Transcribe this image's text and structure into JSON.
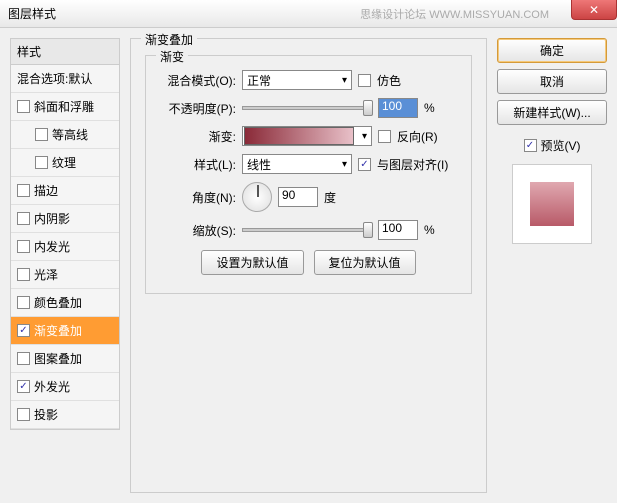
{
  "window": {
    "title": "图层样式",
    "watermark": "思缘设计论坛  WWW.MISSYUAN.COM"
  },
  "left": {
    "header": "样式",
    "blendDefault": "混合选项:默认",
    "items": [
      {
        "label": "斜面和浮雕",
        "checked": false,
        "indent": false
      },
      {
        "label": "等高线",
        "checked": false,
        "indent": true
      },
      {
        "label": "纹理",
        "checked": false,
        "indent": true
      },
      {
        "label": "描边",
        "checked": false,
        "indent": false
      },
      {
        "label": "内阴影",
        "checked": false,
        "indent": false
      },
      {
        "label": "内发光",
        "checked": false,
        "indent": false
      },
      {
        "label": "光泽",
        "checked": false,
        "indent": false
      },
      {
        "label": "颜色叠加",
        "checked": false,
        "indent": false
      },
      {
        "label": "渐变叠加",
        "checked": true,
        "indent": false,
        "selected": true
      },
      {
        "label": "图案叠加",
        "checked": false,
        "indent": false
      },
      {
        "label": "外发光",
        "checked": true,
        "indent": false
      },
      {
        "label": "投影",
        "checked": false,
        "indent": false
      }
    ]
  },
  "middle": {
    "groupTitle": "渐变叠加",
    "subTitle": "渐变",
    "blendMode": {
      "label": "混合模式(O):",
      "value": "正常"
    },
    "dither": "仿色",
    "opacity": {
      "label": "不透明度(P):",
      "value": "100",
      "unit": "%"
    },
    "gradient": {
      "label": "渐变:"
    },
    "reverse": "反向(R)",
    "style": {
      "label": "样式(L):",
      "value": "线性"
    },
    "align": "与图层对齐(I)",
    "angle": {
      "label": "角度(N):",
      "value": "90",
      "unit": "度"
    },
    "scale": {
      "label": "缩放(S):",
      "value": "100",
      "unit": "%"
    },
    "resetBtn": "设置为默认值",
    "restoreBtn": "复位为默认值"
  },
  "right": {
    "ok": "确定",
    "cancel": "取消",
    "newStyle": "新建样式(W)...",
    "preview": "预览(V)"
  }
}
